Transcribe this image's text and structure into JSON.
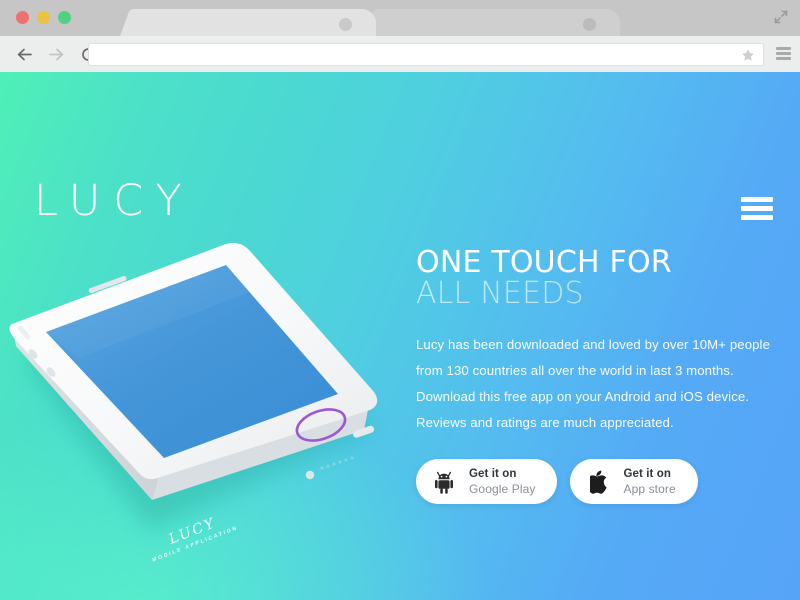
{
  "browser": {
    "traffic_lights": [
      {
        "name": "close",
        "color": "#ef7071"
      },
      {
        "name": "minimize",
        "color": "#e9c342"
      },
      {
        "name": "zoom",
        "color": "#4fd083"
      }
    ],
    "tabs": [
      {
        "title": ""
      },
      {
        "title": ""
      }
    ],
    "address_bar": {
      "value": "",
      "placeholder": ""
    },
    "icons": {
      "back": "back-arrow-icon",
      "forward": "forward-arrow-icon",
      "reload": "reload-icon",
      "bookmark": "star-icon",
      "menu": "hamburger-menu-icon",
      "expand": "expand-fullscreen-icon"
    }
  },
  "site": {
    "logo": "LUCY",
    "nav_menu_icon": "hamburger-menu-icon",
    "hero": {
      "headline_line1": "ONE TOUCH FOR",
      "headline_line2": "ALL NEEDS",
      "paragraph": "Lucy has been downloaded and loved by over 10M+ people from 130 countries all over the world in last 3 months. Download this free app on your Android and iOS device. Reviews and ratings are much appreciated.",
      "buttons": [
        {
          "icon": "android-icon",
          "top_label": "Get it on",
          "bottom_label": "Google Play"
        },
        {
          "icon": "apple-icon",
          "top_label": "Get it on",
          "bottom_label": "App store"
        }
      ]
    },
    "phone": {
      "screen_title": "LUCY",
      "screen_subtitle": "MOBILE APPLICATION",
      "screen_color": "#3f95d8",
      "home_button_color": "#9b59d0",
      "body_color": "#f4f5f6"
    },
    "colors": {
      "gradient_start": "#4ff0b7",
      "gradient_mid": "#4bd8d2",
      "gradient_end": "#56a4f8",
      "text_on_hero": "#ffffff"
    }
  }
}
